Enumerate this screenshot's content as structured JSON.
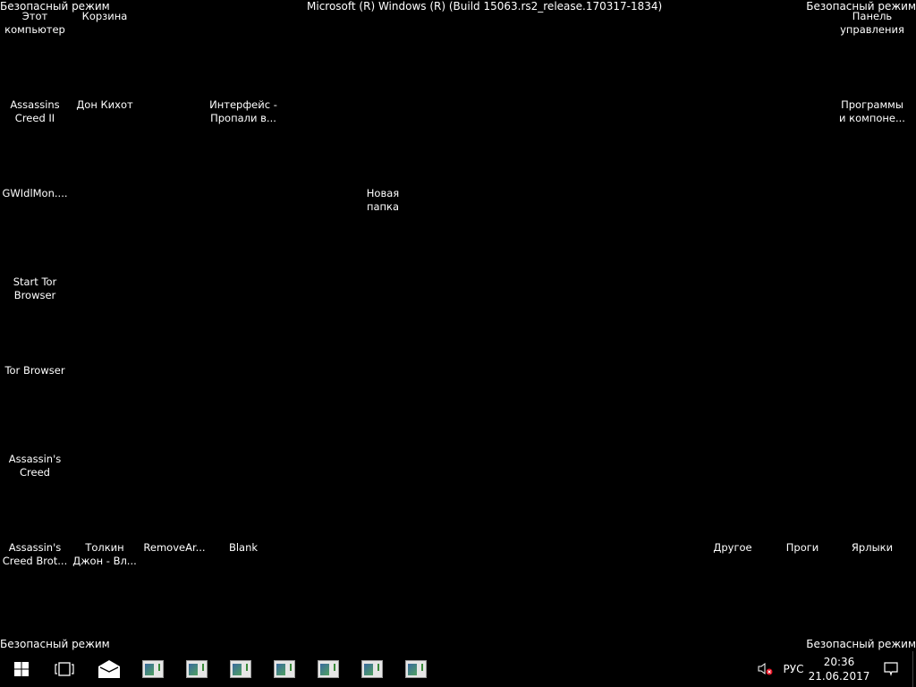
{
  "watermark": {
    "top_left": "Безопасный режим",
    "top_right": "Безопасный режим",
    "bottom_left": "Безопасный режим",
    "bottom_right": "Безопасный режим",
    "build": "Microsoft (R) Windows (R) (Build 15063.rs2_release.170317-1834)"
  },
  "desktop_icons": [
    {
      "line1": "Этот",
      "line2": "компьютер"
    },
    {
      "line1": "Корзина",
      "line2": ""
    },
    {
      "line1": "Панель",
      "line2": "управления"
    },
    {
      "line1": "Assassins",
      "line2": "Creed II"
    },
    {
      "line1": "Дон Кихот",
      "line2": ""
    },
    {
      "line1": "Интерфейс -",
      "line2": "Пропали в..."
    },
    {
      "line1": "Программы",
      "line2": "и компоне..."
    },
    {
      "line1": "GWIdlMon....",
      "line2": ""
    },
    {
      "line1": "Новая папка",
      "line2": ""
    },
    {
      "line1": "Start Tor",
      "line2": "Browser"
    },
    {
      "line1": "Tor Browser",
      "line2": ""
    },
    {
      "line1": "Assassin's",
      "line2": "Creed"
    },
    {
      "line1": "Assassin's",
      "line2": "Creed Brot..."
    },
    {
      "line1": "Толкин",
      "line2": "Джон - Вл..."
    },
    {
      "line1": "RemoveAr...",
      "line2": ""
    },
    {
      "line1": "Blank",
      "line2": ""
    },
    {
      "line1": "Другое",
      "line2": ""
    },
    {
      "line1": "Проги",
      "line2": ""
    },
    {
      "line1": "Ярлыки",
      "line2": ""
    }
  ],
  "taskbar": {
    "start_icon": "windows-logo-icon",
    "task_view_icon": "task-view-icon",
    "mail_icon": "mail-icon",
    "app_window_count": 7,
    "language": "РУС",
    "time": "20:36",
    "date": "21.06.2017",
    "volume_icon": "volume-muted-icon",
    "notification_icon": "action-center-icon"
  }
}
